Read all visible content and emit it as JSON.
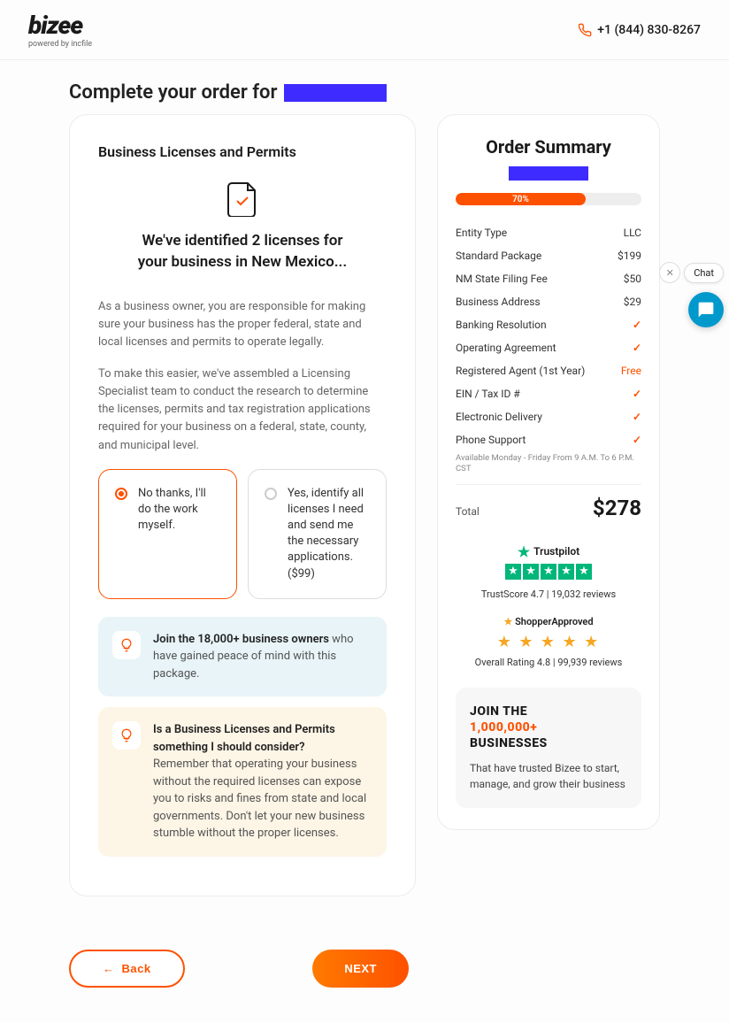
{
  "header": {
    "logo": "bizee",
    "logo_sub": "powered by incfile",
    "phone": "+1 (844) 830-8267"
  },
  "page_title": "Complete your order for ",
  "main": {
    "section_title": "Business Licenses and Permits",
    "identified": "We've identified 2 licenses for your business in New Mexico...",
    "para1": "As a business owner, you are responsible for making sure your business has the proper federal, state and local licenses and permits to operate legally.",
    "para2": "To make this easier, we've assembled a Licensing Specialist team to conduct the research to determine the licenses, permits and tax registration applications required for your business on a federal, state, county, and municipal level.",
    "option_no": "No thanks, I'll do the work myself.",
    "option_yes": "Yes, identify all licenses I need and send me the necessary applications. ($99)",
    "info_blue_bold": "Join the 18,000+ business owners",
    "info_blue_rest": " who have gained peace of mind with this package.",
    "info_yellow_q": "Is a Business Licenses and Permits something I should consider?",
    "info_yellow_a": "Remember that operating your business without the required licenses can expose you to risks and fines from state and local governments. Don't let your new business stumble without the proper licenses."
  },
  "nav": {
    "back": "Back",
    "next": "NEXT"
  },
  "summary": {
    "title": "Order Summary",
    "progress_pct": "70%",
    "progress_width": "70%",
    "items": [
      {
        "label": "Entity Type",
        "value": "LLC"
      },
      {
        "label": "Standard Package",
        "value": "$199"
      },
      {
        "label": "NM State Filing Fee",
        "value": "$50"
      },
      {
        "label": "Business Address",
        "value": "$29"
      },
      {
        "label": "Banking Resolution",
        "value": "check"
      },
      {
        "label": "Operating Agreement",
        "value": "check"
      },
      {
        "label": "Registered Agent (1st Year)",
        "value": "Free"
      },
      {
        "label": "EIN / Tax ID #",
        "value": "check"
      },
      {
        "label": "Electronic Delivery",
        "value": "check"
      },
      {
        "label": "Phone Support",
        "value": "check"
      }
    ],
    "fine_print": "Available Monday - Friday From 9 A.M. To 6 P.M. CST",
    "total_label": "Total",
    "total_amount": "$278"
  },
  "trust": {
    "name": "Trustpilot",
    "score_text": "TrustScore 4.7 | 19,032 reviews"
  },
  "shopper": {
    "name": "ShopperApproved",
    "rating_text": "Overall Rating 4.8 | 99,939 reviews"
  },
  "join": {
    "line1": "JOIN THE",
    "line2": "1,000,000+",
    "line3": "BUSINESSES",
    "body": "That have trusted Bizee to start, manage, and grow their business"
  },
  "chat": {
    "label": "Chat"
  }
}
